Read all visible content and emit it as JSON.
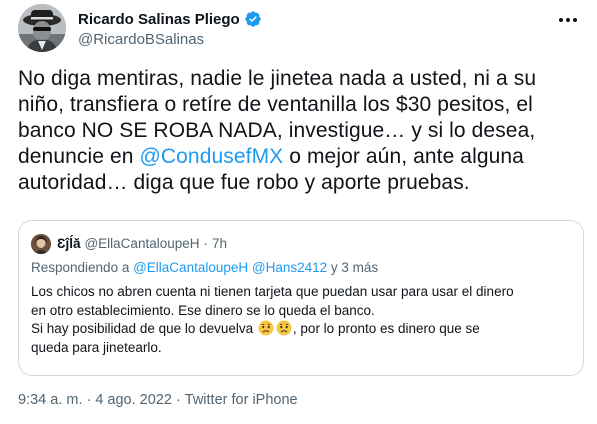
{
  "author": {
    "display_name": "Ricardo Salinas Pliego",
    "handle": "@RicardoBSalinas",
    "avatar_icon": "profile-photo",
    "verified_color": "#1d9bf0"
  },
  "tweet": {
    "lines": [
      "No diga mentiras, nadie le jinetea nada a usted, ni a su",
      "niño, transfiera o retíre de ventanilla los $30 pesitos, el",
      "banco NO SE ROBA NADA, investigue… y si lo desea,"
    ],
    "line4_before": "denuncie en ",
    "mention": "@CondusefMX",
    "line4_after": " o mejor aún, ante alguna",
    "line5": "autoridad… diga que fue robo y aporte pruebas."
  },
  "quote": {
    "name": "Ɛĵĺă",
    "handle": "@EllaCantaloupeH",
    "separator": "·",
    "time": "7h",
    "reply_prefix": "Respondiendo a ",
    "reply_to": "@EllaCantaloupeH @Hans2412",
    "reply_suffix": " y 3 más",
    "body_lines": [
      "Los chicos no abren cuenta ni tienen tarjeta que puedan usar para usar el dinero",
      "en otro establecimiento. Ese dinero se lo queda el banco."
    ],
    "line3_before": "Si hay posibilidad de que lo devuelva ",
    "line3_after": ", por lo pronto es dinero que se",
    "line4": "queda para jinetearlo."
  },
  "meta": {
    "time": "9:34 a. m.",
    "separator": "·",
    "date": "4 ago. 2022",
    "source": "Twitter for iPhone"
  },
  "colors": {
    "link": "#1d9bf0",
    "secondary_text": "#536471",
    "border": "#cfd9de"
  }
}
